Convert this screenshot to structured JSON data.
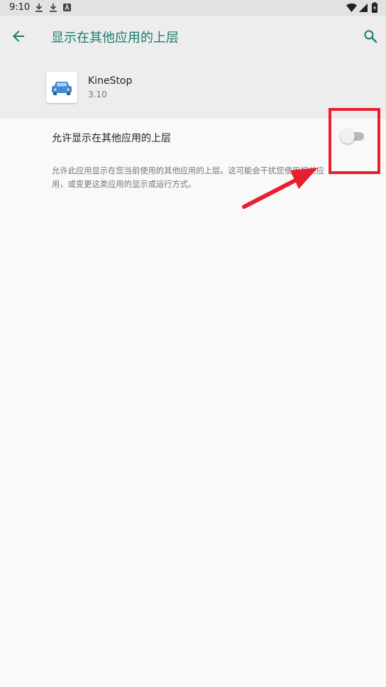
{
  "status_bar": {
    "time": "9:10",
    "left_icons": [
      "download-icon",
      "download-icon",
      "a-badge-icon"
    ],
    "right_icons": [
      "wifi-icon",
      "signal-icon",
      "battery-charging-icon"
    ]
  },
  "app_bar": {
    "title": "显示在其他应用的上层",
    "back_icon": "arrow-back-icon",
    "search_icon": "search-icon",
    "accent_color": "#1a7a6e"
  },
  "app": {
    "name": "KineStop",
    "version": "3.10",
    "icon": "car-icon"
  },
  "setting": {
    "label": "允许显示在其他应用的上层",
    "enabled": false
  },
  "description": {
    "line1": "允许此应用显示在您当前使用的其他应用的上层。这可能会干扰您使用相关应",
    "line2": "用，或变更这类应用的显示或运行方式。"
  },
  "annotation": {
    "color": "#e81f2f"
  }
}
